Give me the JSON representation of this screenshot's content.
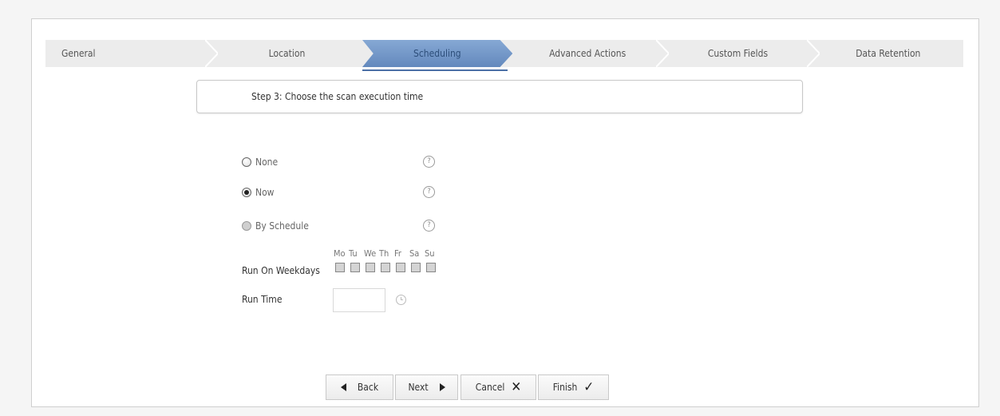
{
  "wizard": {
    "steps": [
      {
        "label": "General"
      },
      {
        "label": "Location"
      },
      {
        "label": "Scheduling",
        "active": true
      },
      {
        "label": "Advanced Actions"
      },
      {
        "label": "Custom Fields"
      },
      {
        "label": "Data Retention"
      }
    ]
  },
  "step_heading": "Step 3: Choose the scan execution time",
  "schedule_options": [
    {
      "label": "None",
      "selected": false,
      "help_icon": "question-icon"
    },
    {
      "label": "Now",
      "selected": true,
      "help_icon": "question-icon"
    },
    {
      "label": "By Schedule",
      "selected": false,
      "help_icon": "question-icon"
    }
  ],
  "help_glyph": "?",
  "weekdays": {
    "label": "Run On Weekdays",
    "days": [
      "Mo",
      "Tu",
      "We",
      "Th",
      "Fr",
      "Sa",
      "Su"
    ],
    "checked": [
      false,
      false,
      false,
      false,
      false,
      false,
      false
    ]
  },
  "run_time": {
    "label": "Run Time",
    "value": "",
    "icon": "clock-icon"
  },
  "buttons": {
    "back": "Back",
    "next": "Next",
    "cancel": "Cancel",
    "finish": "Finish"
  },
  "colors": {
    "active_step": "#6f95c7",
    "active_underline": "#4a6fa5",
    "steps_bar": "#ececec"
  }
}
